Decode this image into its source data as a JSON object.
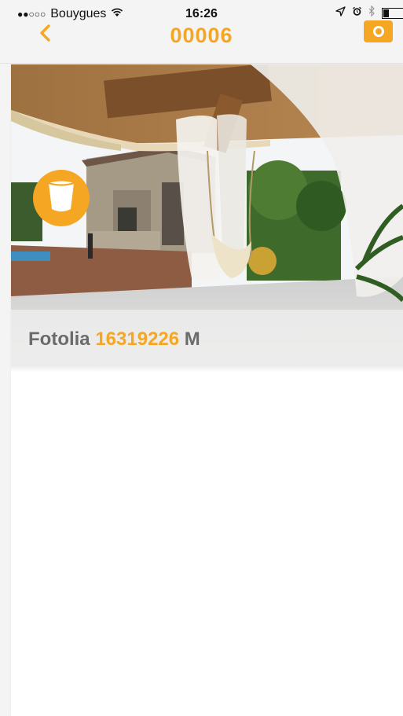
{
  "status_bar": {
    "signal": "●●○○○",
    "carrier": "Bouygues",
    "wifi_icon": "wifi-icon",
    "time": "16:26",
    "location_icon": "location-arrow-icon",
    "alarm_icon": "alarm-icon",
    "bluetooth_icon": "bluetooth-icon",
    "battery_level": 0.25
  },
  "nav": {
    "back_icon": "chevron-left-icon",
    "title": "00006",
    "camera_icon": "camera-icon"
  },
  "media": {
    "badge_icon": "bucket-icon",
    "caption_prefix": "Fotolia",
    "caption_number": "16319226",
    "caption_suffix": "M"
  },
  "colors": {
    "accent": "#F5A623",
    "caption_gray": "#6b6b6b",
    "background": "#f4f4f4"
  }
}
